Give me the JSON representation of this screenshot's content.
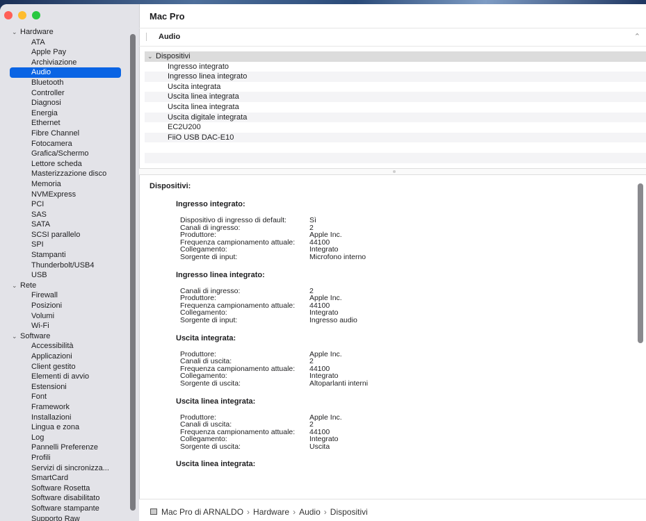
{
  "sidebar": {
    "rows": [
      {
        "label": "Hardware",
        "kind": "group"
      },
      {
        "label": "ATA",
        "kind": "item"
      },
      {
        "label": "Apple Pay",
        "kind": "item"
      },
      {
        "label": "Archiviazione",
        "kind": "item"
      },
      {
        "label": "Audio",
        "kind": "item",
        "selected": true
      },
      {
        "label": "Bluetooth",
        "kind": "item"
      },
      {
        "label": "Controller",
        "kind": "item"
      },
      {
        "label": "Diagnosi",
        "kind": "item"
      },
      {
        "label": "Energia",
        "kind": "item"
      },
      {
        "label": "Ethernet",
        "kind": "item"
      },
      {
        "label": "Fibre Channel",
        "kind": "item"
      },
      {
        "label": "Fotocamera",
        "kind": "item"
      },
      {
        "label": "Grafica/Schermo",
        "kind": "item"
      },
      {
        "label": "Lettore scheda",
        "kind": "item"
      },
      {
        "label": "Masterizzazione disco",
        "kind": "item"
      },
      {
        "label": "Memoria",
        "kind": "item"
      },
      {
        "label": "NVMExpress",
        "kind": "item"
      },
      {
        "label": "PCI",
        "kind": "item"
      },
      {
        "label": "SAS",
        "kind": "item"
      },
      {
        "label": "SATA",
        "kind": "item"
      },
      {
        "label": "SCSI parallelo",
        "kind": "item"
      },
      {
        "label": "SPI",
        "kind": "item"
      },
      {
        "label": "Stampanti",
        "kind": "item"
      },
      {
        "label": "Thunderbolt/USB4",
        "kind": "item"
      },
      {
        "label": "USB",
        "kind": "item"
      },
      {
        "label": "Rete",
        "kind": "group"
      },
      {
        "label": "Firewall",
        "kind": "item"
      },
      {
        "label": "Posizioni",
        "kind": "item"
      },
      {
        "label": "Volumi",
        "kind": "item"
      },
      {
        "label": "Wi-Fi",
        "kind": "item"
      },
      {
        "label": "Software",
        "kind": "group"
      },
      {
        "label": "Accessibilità",
        "kind": "item"
      },
      {
        "label": "Applicazioni",
        "kind": "item"
      },
      {
        "label": "Client gestito",
        "kind": "item"
      },
      {
        "label": "Elementi di avvio",
        "kind": "item"
      },
      {
        "label": "Estensioni",
        "kind": "item"
      },
      {
        "label": "Font",
        "kind": "item"
      },
      {
        "label": "Framework",
        "kind": "item"
      },
      {
        "label": "Installazioni",
        "kind": "item"
      },
      {
        "label": "Lingua e zona",
        "kind": "item"
      },
      {
        "label": "Log",
        "kind": "item"
      },
      {
        "label": "Pannelli Preferenze",
        "kind": "item"
      },
      {
        "label": "Profili",
        "kind": "item"
      },
      {
        "label": "Servizi di sincronizza...",
        "kind": "item"
      },
      {
        "label": "SmartCard",
        "kind": "item"
      },
      {
        "label": "Software Rosetta",
        "kind": "item"
      },
      {
        "label": "Software disabilitato",
        "kind": "item"
      },
      {
        "label": "Software stampante",
        "kind": "item"
      },
      {
        "label": "Supporto Raw",
        "kind": "item"
      }
    ]
  },
  "main": {
    "title": "Mac Pro",
    "section_label": "Audio",
    "tree_header": "Dispositivi",
    "tree_items": [
      "Ingresso integrato",
      "Ingresso linea integrato",
      "Uscita integrata",
      "Uscita linea integrata",
      "Uscita linea integrata",
      "Uscita digitale integrata",
      "EC2U200",
      "FiiO USB DAC-E10"
    ],
    "detail_title": "Dispositivi:",
    "devices": [
      {
        "name": "Ingresso integrato:",
        "props": [
          [
            "Dispositivo di ingresso di default:",
            "Sì"
          ],
          [
            "Canali di ingresso:",
            "2"
          ],
          [
            "Produttore:",
            "Apple Inc."
          ],
          [
            "Frequenza campionamento attuale:",
            "44100"
          ],
          [
            "Collegamento:",
            "Integrato"
          ],
          [
            "Sorgente di input:",
            "Microfono interno"
          ]
        ]
      },
      {
        "name": "Ingresso linea integrato:",
        "props": [
          [
            "Canali di ingresso:",
            "2"
          ],
          [
            "Produttore:",
            "Apple Inc."
          ],
          [
            "Frequenza campionamento attuale:",
            "44100"
          ],
          [
            "Collegamento:",
            "Integrato"
          ],
          [
            "Sorgente di input:",
            "Ingresso audio"
          ]
        ]
      },
      {
        "name": "Uscita integrata:",
        "props": [
          [
            "Produttore:",
            "Apple Inc."
          ],
          [
            "Canali di uscita:",
            "2"
          ],
          [
            "Frequenza campionamento attuale:",
            "44100"
          ],
          [
            "Collegamento:",
            "Integrato"
          ],
          [
            "Sorgente di uscita:",
            "Altoparlanti interni"
          ]
        ]
      },
      {
        "name": "Uscita linea integrata:",
        "props": [
          [
            "Produttore:",
            "Apple Inc."
          ],
          [
            "Canali di uscita:",
            "2"
          ],
          [
            "Frequenza campionamento attuale:",
            "44100"
          ],
          [
            "Collegamento:",
            "Integrato"
          ],
          [
            "Sorgente di uscita:",
            "Uscita"
          ]
        ]
      },
      {
        "name": "Uscita linea integrata:",
        "props": []
      }
    ]
  },
  "statusbar": {
    "path": [
      "Mac Pro di ARNALDO",
      "Hardware",
      "Audio",
      "Dispositivi"
    ],
    "separator": "›"
  },
  "icons": {
    "disclosure_open": "chevron-down-icon",
    "collapse": "chevron-up-icon",
    "computer": "mac-pro-icon"
  },
  "colors": {
    "selection": "#0a64e4",
    "close": "#ff5f57",
    "minimize": "#febc2e",
    "zoom": "#28c840"
  }
}
